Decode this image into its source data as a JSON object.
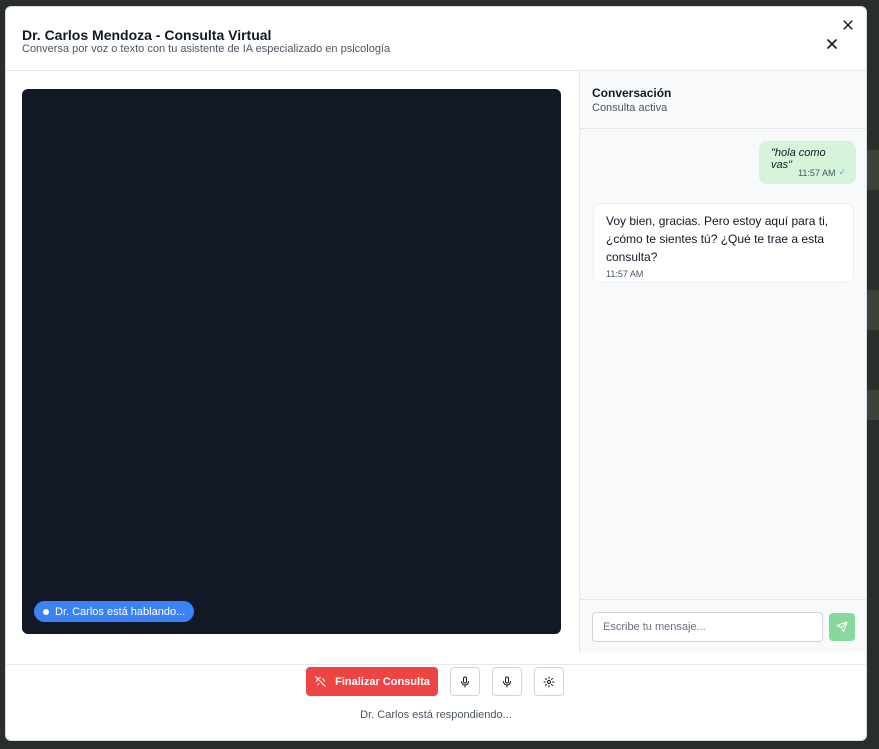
{
  "modal": {
    "title": "Dr. Carlos Mendoza - Consulta Virtual",
    "subtitle": "Conversa por voz o texto con tu asistente de IA especializado en psicología"
  },
  "video": {
    "speaking_badge": "Dr. Carlos está hablando..."
  },
  "chat": {
    "title": "Conversación",
    "status": "Consulta activa",
    "messages": [
      {
        "role": "user",
        "text": "\"hola como vas\"",
        "time": "11:57 AM"
      },
      {
        "role": "assistant",
        "text": "Voy bien, gracias. Pero estoy aquí para ti, ¿cómo te sientes tú? ¿Qué te trae a esta consulta?",
        "time": "11:57 AM"
      }
    ],
    "input_placeholder": "Escribe tu mensaje..."
  },
  "footer": {
    "end_button": "Finalizar Consulta",
    "status": "Dr. Carlos está respondiendo..."
  },
  "colors": {
    "accent_red": "#ef4444",
    "accent_blue": "#3b82f6",
    "user_bubble": "#d5f4d9",
    "send_button": "#86d99a"
  },
  "icons": [
    "close-icon",
    "phone-off-icon",
    "microphone-icon",
    "settings-icon",
    "send-icon",
    "double-check-icon"
  ]
}
